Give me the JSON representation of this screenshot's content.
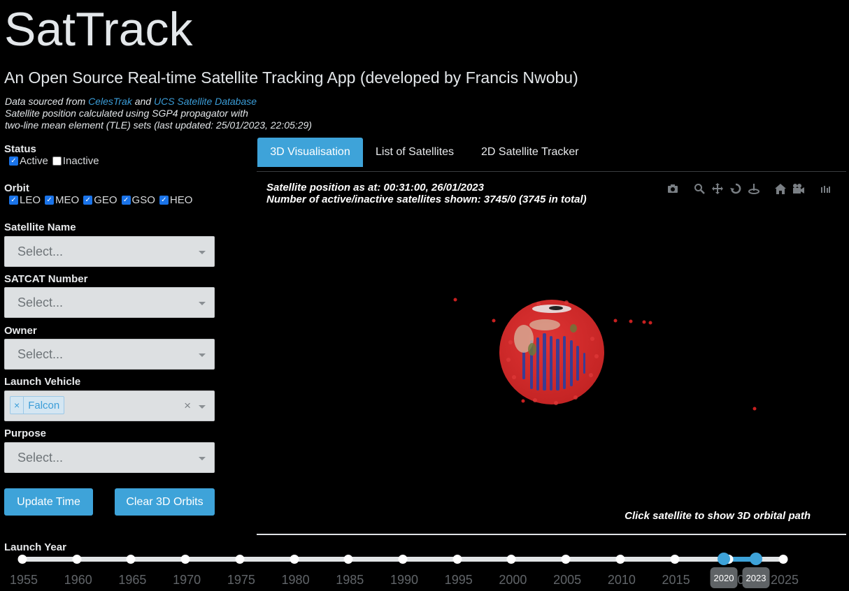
{
  "header": {
    "title": "SatTrack",
    "subtitle": "An Open Source Real-time Satellite Tracking App (developed by Francis Nwobu)",
    "source_prefix": "Data sourced from ",
    "source_link1": "CelesTrak",
    "source_and": " and ",
    "source_link2": "UCS Satellite Database",
    "line2": "Satellite position calculated using SGP4 propagator with",
    "line3": "two-line mean element (TLE) sets (last updated: 25/01/2023, 22:05:29)"
  },
  "filters": {
    "status_label": "Status",
    "status_options": [
      {
        "label": "Active",
        "checked": true
      },
      {
        "label": "Inactive",
        "checked": false
      }
    ],
    "orbit_label": "Orbit",
    "orbit_options": [
      {
        "label": "LEO",
        "checked": true
      },
      {
        "label": "MEO",
        "checked": true
      },
      {
        "label": "GEO",
        "checked": true
      },
      {
        "label": "GSO",
        "checked": true
      },
      {
        "label": "HEO",
        "checked": true
      }
    ],
    "satellite_name_label": "Satellite Name",
    "satcat_label": "SATCAT Number",
    "owner_label": "Owner",
    "launch_vehicle_label": "Launch Vehicle",
    "launch_vehicle_value": "Falcon",
    "purpose_label": "Purpose",
    "placeholder": "Select...",
    "clear_symbol": "×"
  },
  "buttons": {
    "update_time": "Update Time",
    "clear_orbits": "Clear 3D Orbits"
  },
  "tabs": [
    {
      "label": "3D Visualisation",
      "active": true
    },
    {
      "label": "List of Satellites",
      "active": false
    },
    {
      "label": "2D Satellite Tracker",
      "active": false
    }
  ],
  "plot": {
    "position_line": "Satellite position as at: 00:31:00, 26/01/2023",
    "count_line": "Number of active/inactive satellites shown: 3745/0 (3745 in total)",
    "hint": "Click satellite to show 3D orbital path",
    "modebar_icons": [
      "camera-icon",
      "zoom-icon",
      "pan-icon",
      "orbit-rotation-icon",
      "turntable-icon",
      "home-icon",
      "video-camera-icon",
      "plotly-logo-icon"
    ]
  },
  "launch_year": {
    "label": "Launch Year",
    "ticks": [
      "1955",
      "1960",
      "1965",
      "1970",
      "1975",
      "1980",
      "1985",
      "1990",
      "1995",
      "2000",
      "2005",
      "2010",
      "2015",
      "2020",
      "2025"
    ],
    "range_start": "2020",
    "range_end": "2023",
    "min": 1955,
    "max": 2025,
    "selected": [
      2020,
      2023
    ]
  },
  "colors": {
    "accent": "#3ea3d9",
    "satellite": "#d22a2a",
    "background": "#000000"
  }
}
